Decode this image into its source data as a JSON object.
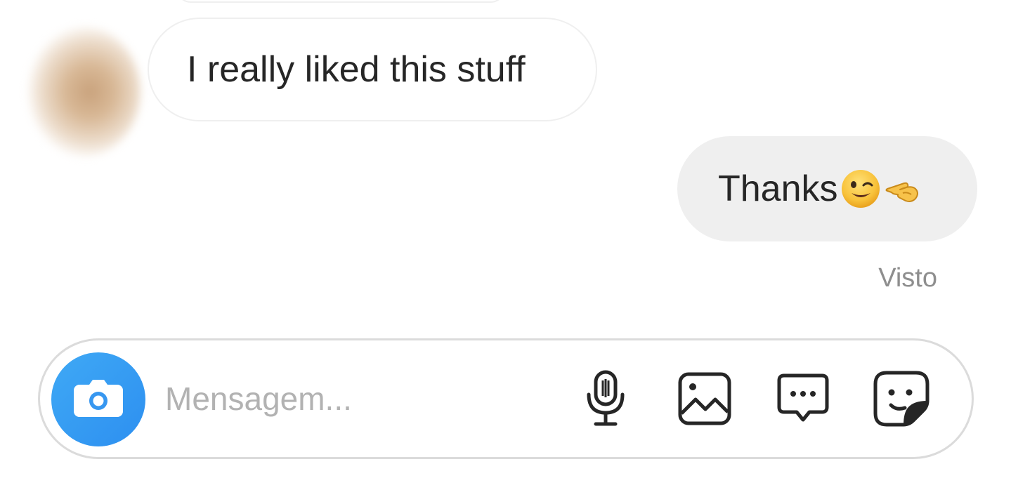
{
  "thread": {
    "incoming_message": "I really liked this stuff",
    "outgoing_message": "Thanks",
    "outgoing_emojis": [
      "winking-face",
      "backhand-index-pointing-left"
    ],
    "seen_label": "Visto"
  },
  "composer": {
    "placeholder": "Mensagem...",
    "value": "",
    "icons": [
      "camera-icon",
      "microphone-icon",
      "gallery-icon",
      "chat-bubble-icon",
      "sticker-icon"
    ]
  },
  "colors": {
    "camera_button": "#3797f0",
    "outgoing_bubble": "#efefef",
    "incoming_border": "#efefef",
    "seen_text": "#8e8e8e",
    "placeholder_text": "#b2b2b2"
  }
}
